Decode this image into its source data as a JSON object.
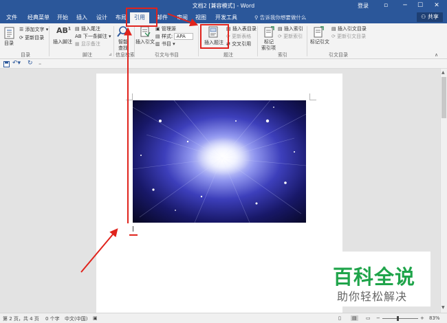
{
  "window": {
    "title": "文档2 [兼容模式] - Word",
    "login": "登录",
    "controls": [
      "▫",
      "─",
      "☐",
      "✕"
    ]
  },
  "tabs": [
    "文件",
    "经典菜单",
    "开始",
    "插入",
    "设计",
    "布局",
    "引用",
    "邮件",
    "审阅",
    "视图",
    "开发工具"
  ],
  "active_tab": "引用",
  "tellme": "告诉我你想要做什么",
  "share": "共享",
  "ribbon": {
    "toc": {
      "big": "目录",
      "add_text": "添加文字",
      "update": "更新目录",
      "group": "目录"
    },
    "footnotes": {
      "insert": "插入脚注",
      "endnote": "插入尾注",
      "next": "下一条脚注",
      "show": "显示备注",
      "group": "脚注"
    },
    "research": {
      "smart": "智能",
      "lookup": "查找",
      "group": "信息检索"
    },
    "citations": {
      "insert": "插入引文",
      "manage": "管理源",
      "style_label": "样式:",
      "style_value": "APA",
      "biblio": "书目",
      "group": "引文与书目"
    },
    "captions": {
      "insert": "插入题注",
      "table_fig": "插入表目录",
      "update": "更新表格",
      "cross": "交叉引用",
      "group": "题注"
    },
    "index": {
      "mark": "标记",
      "entry": "索引项",
      "insert": "插入索引",
      "update": "更新索引",
      "group": "索引"
    },
    "toa": {
      "mark": "标记引文",
      "insert": "插入引文目录",
      "update": "更新引文目录",
      "group": "引文目录"
    }
  },
  "status": {
    "page": "第 2 页，共 4 页",
    "words": "0 个字",
    "lang": "中文(中国)",
    "zoom": "83%"
  },
  "watermark": {
    "big": "百科全说",
    "small": "助你轻松解决"
  },
  "colors": {
    "word_blue": "#2b579a",
    "annotation_red": "#e0231c",
    "watermark_green": "#1fa44a"
  }
}
